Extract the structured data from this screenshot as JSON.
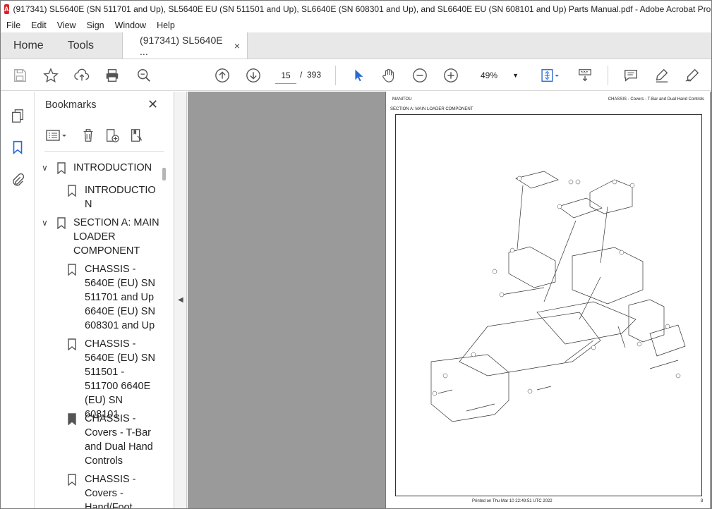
{
  "window": {
    "title": "(917341) SL5640E (SN 511701 and Up), SL5640E EU (SN 511501 and Up), SL6640E (SN 608301 and Up), and SL6640E EU (SN 608101 and Up) Parts Manual.pdf - Adobe Acrobat Pro DC (32-bit)",
    "app_icon": "A"
  },
  "menu": [
    "File",
    "Edit",
    "View",
    "Sign",
    "Window",
    "Help"
  ],
  "tabs": {
    "home": "Home",
    "tools": "Tools",
    "doc": "(917341) SL5640E ...",
    "close": "×"
  },
  "toolbar": {
    "page_current": "15",
    "page_sep": "/",
    "page_total": "393",
    "zoom": "49%",
    "icons": [
      "save-icon",
      "star-icon",
      "upload-icon",
      "print-icon",
      "zoom-search-icon",
      "page-up-icon",
      "page-down-icon",
      "select-cursor-icon",
      "hand-icon",
      "zoom-out-icon",
      "zoom-in-icon",
      "fit-page-icon",
      "scan-icon",
      "comment-icon",
      "highlight-icon",
      "sign-icon"
    ]
  },
  "bookmarks": {
    "title": "Bookmarks",
    "close": "✕",
    "items": [
      {
        "label": "INTRODUCTION",
        "level": 0,
        "expanded": true
      },
      {
        "label": "INTRODUCTIO\nN",
        "level": 1
      },
      {
        "label": "SECTION A: MAIN\nLOADER\nCOMPONENT",
        "level": 0,
        "expanded": true
      },
      {
        "label": "CHASSIS -\n5640E (EU) SN\n511701 and Up\n6640E (EU) SN\n608301 and Up",
        "level": 1
      },
      {
        "label": "CHASSIS -\n5640E (EU) SN\n511501 -\n511700 6640E\n(EU) SN 608101",
        "level": 1
      },
      {
        "label": "CHASSIS -\nCovers - T-Bar\nand Dual Hand\nControls",
        "level": 1
      },
      {
        "label": "CHASSIS -\nCovers -\nHand/Foot",
        "level": 1
      }
    ]
  },
  "page": {
    "header_left": "MANITOU",
    "header_right": "CHASSIS - Covers - T-Bar and Dual Hand Controls",
    "section": "SECTION A: MAIN LOADER COMPONENT",
    "footer": "Printed on  Thu Mar 10 22:49:51 UTC 2022",
    "page_number": "8"
  }
}
